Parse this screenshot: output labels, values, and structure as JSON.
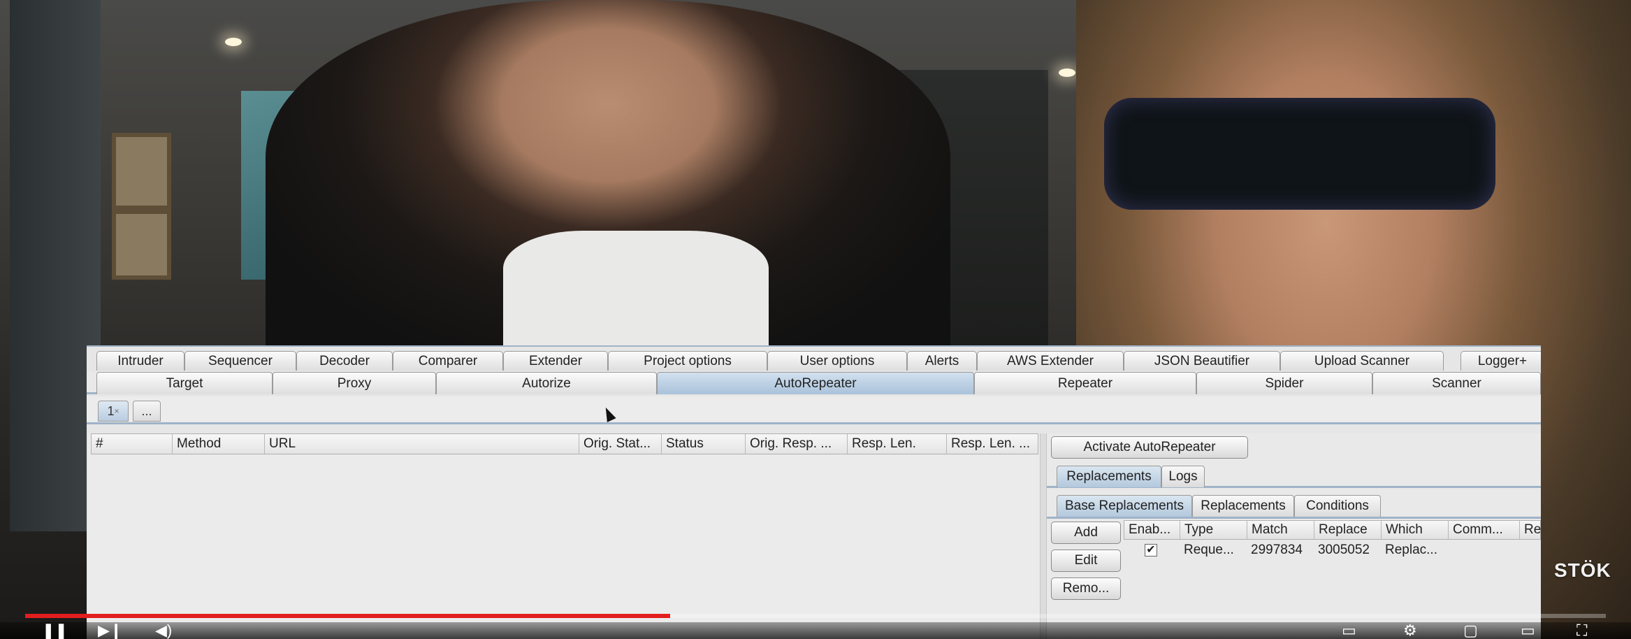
{
  "burp": {
    "tabs_row1": [
      "Intruder",
      "Sequencer",
      "Decoder",
      "Comparer",
      "Extender",
      "Project options",
      "User options",
      "Alerts",
      "AWS Extender",
      "JSON Beautifier",
      "Upload Scanner",
      "Logger+"
    ],
    "tabs_row2": [
      "Target",
      "Proxy",
      "Autorize",
      "AutoRepeater",
      "Repeater",
      "Spider",
      "Scanner"
    ],
    "active_tab": "AutoRepeater",
    "subtabs": {
      "first": "1",
      "close": "×",
      "more": "..."
    },
    "table": {
      "columns": [
        "#",
        "Method",
        "URL",
        "Orig. Stat...",
        "Status",
        "Orig. Resp. ...",
        "Resp. Len.",
        "Resp. Len. ..."
      ]
    },
    "right": {
      "activate_label": "Activate AutoRepeater",
      "tabs": [
        "Replacements",
        "Logs"
      ],
      "subtabs": [
        "Base Replacements",
        "Replacements",
        "Conditions"
      ],
      "buttons": [
        "Add",
        "Edit",
        "Remo..."
      ],
      "columns": [
        "Enab...",
        "Type",
        "Match",
        "Replace",
        "Which",
        "Comm...",
        "Reg"
      ],
      "row": {
        "type": "Reque...",
        "match": "2997834",
        "replace": "3005052",
        "which": "Replac...",
        "comment": "",
        "checked": "✔"
      }
    }
  },
  "video": {
    "watermark": "STÖK",
    "progress_fraction": 0.408
  }
}
